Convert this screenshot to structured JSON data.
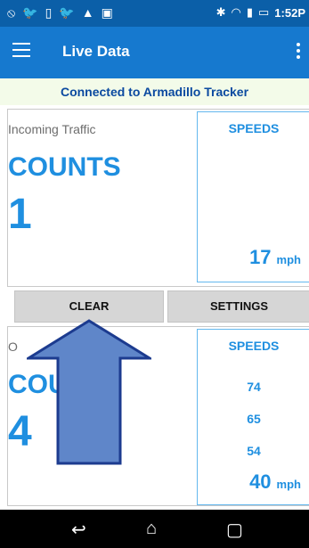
{
  "status": {
    "time": "1:52",
    "time_suffix": "P",
    "left_icons": [
      "notification-icon",
      "twitter-icon",
      "phone-icon",
      "twitter-icon",
      "warning-icon",
      "image-icon"
    ],
    "right_icons": [
      "bluetooth-icon",
      "wifi-icon",
      "signal-icon",
      "battery-icon"
    ]
  },
  "appbar": {
    "title": "Live Data"
  },
  "banner": {
    "text": "Connected to Armadillo Tracker"
  },
  "incoming": {
    "label": "Incoming Traffic",
    "counts_label": "COUNTS",
    "count": "1",
    "speeds_title": "SPEEDS",
    "speed_main": "17",
    "speed_unit": "mph"
  },
  "buttons": {
    "clear": "CLEAR",
    "settings": "SETTINGS"
  },
  "outgoing": {
    "label": "O",
    "counts_label": "COUNTS",
    "count": "4",
    "speeds_title": "SPEEDS",
    "speeds_list": [
      "74",
      "65",
      "54"
    ],
    "speed_main": "40",
    "speed_unit": "mph"
  },
  "navbar": {
    "back_icon": "back-icon",
    "home_icon": "home-icon",
    "recents_icon": "recents-icon"
  },
  "colors": {
    "status_bar": "#0b5fa8",
    "app_bar": "#1679cf",
    "accent": "#1f8fe0",
    "banner_bg": "#f3fbe9",
    "arrow_fill": "#5f86c9"
  }
}
